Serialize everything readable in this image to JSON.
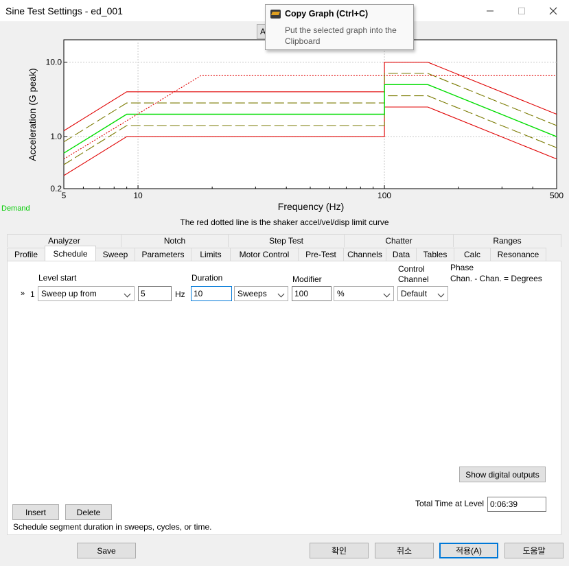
{
  "window": {
    "title": "Sine Test Settings - ed_001",
    "minimize_icon": "minimize-icon",
    "maximize_icon": "maximize-icon",
    "close_icon": "close-icon"
  },
  "toolbar": {
    "a_button_label": "A"
  },
  "tooltip": {
    "title": "Copy Graph (Ctrl+C)",
    "body": "Put the selected graph into the Clipboard",
    "icon": "copy-graph-icon"
  },
  "chart_data": {
    "type": "line",
    "xlabel": "Frequency (Hz)",
    "ylabel": "Acceleration (G peak)",
    "x_scale": "log",
    "y_scale": "log",
    "xlim": [
      5,
      500
    ],
    "ylim": [
      0.2,
      20
    ],
    "x_ticks": [
      5,
      10,
      100,
      500
    ],
    "x_tick_labels": [
      "5",
      "10",
      "100",
      "500"
    ],
    "y_ticks": [
      0.2,
      1.0,
      10.0
    ],
    "y_tick_labels": [
      "0.2",
      "1.0",
      "10.0"
    ],
    "grid": true,
    "series": [
      {
        "color": "#e00000",
        "dash": "solid",
        "x": [
          5,
          9,
          100,
          100,
          150,
          500
        ],
        "y": [
          1.2,
          4,
          4,
          10,
          10,
          2
        ]
      },
      {
        "color": "#e00000",
        "dash": "solid",
        "x": [
          5,
          9,
          100,
          100,
          150,
          500
        ],
        "y": [
          0.3,
          1,
          1,
          2.5,
          2.5,
          0.5
        ]
      },
      {
        "color": "#7a7a00",
        "dash": "dashed",
        "x": [
          5,
          9,
          100,
          100,
          150,
          500
        ],
        "y": [
          0.85,
          2.83,
          2.83,
          7.07,
          7.07,
          1.41
        ]
      },
      {
        "color": "#7a7a00",
        "dash": "dashed",
        "x": [
          5,
          9,
          100,
          100,
          150,
          500
        ],
        "y": [
          0.42,
          1.41,
          1.41,
          3.54,
          3.54,
          0.71
        ]
      },
      {
        "color": "#00dd00",
        "dash": "solid",
        "x": [
          5,
          9,
          100,
          100,
          150,
          500
        ],
        "y": [
          0.6,
          2,
          2,
          5,
          5,
          1
        ]
      },
      {
        "color": "#e00000",
        "dash": "dotted",
        "x": [
          5,
          18,
          500
        ],
        "y": [
          0.5,
          6.6,
          6.6
        ]
      }
    ]
  },
  "demand_label": "Demand",
  "chart_note": "The red dotted line is the shaker accel/vel/disp limit curve",
  "tabs": {
    "row1": [
      "Analyzer",
      "Notch",
      "Step Test",
      "Chatter",
      "Ranges"
    ],
    "row2": [
      "Profile",
      "Schedule",
      "Sweep",
      "Parameters",
      "Limits",
      "Motor Control",
      "Pre-Test",
      "Channels",
      "Data",
      "Tables",
      "Calc",
      "Resonance"
    ],
    "active": "Schedule"
  },
  "schedule": {
    "headers": {
      "level_start": "Level start",
      "duration": "Duration",
      "modifier": "Modifier",
      "control_channel_1": "Control",
      "control_channel_2": "Channel",
      "phase_1": "Phase",
      "phase_2": "Chan. - Chan. = Degrees"
    },
    "row": {
      "marker": "»",
      "index": "1",
      "level_start_value": "Sweep up from",
      "frequency_value": "5",
      "frequency_unit": "Hz",
      "duration_value": "10",
      "duration_unit": "Sweeps",
      "modifier_value": "100",
      "modifier_unit": "%",
      "control_channel": "Default"
    },
    "show_digital_outputs": "Show digital outputs",
    "total_time_label": "Total Time at Level",
    "total_time_value": "0:06:39",
    "insert_label": "Insert",
    "delete_label": "Delete",
    "status_text": "Schedule segment duration in sweeps, cycles, or time."
  },
  "footer": {
    "save": "Save",
    "ok": "확인",
    "cancel": "취소",
    "apply": "적용(A)",
    "help": "도움말"
  }
}
